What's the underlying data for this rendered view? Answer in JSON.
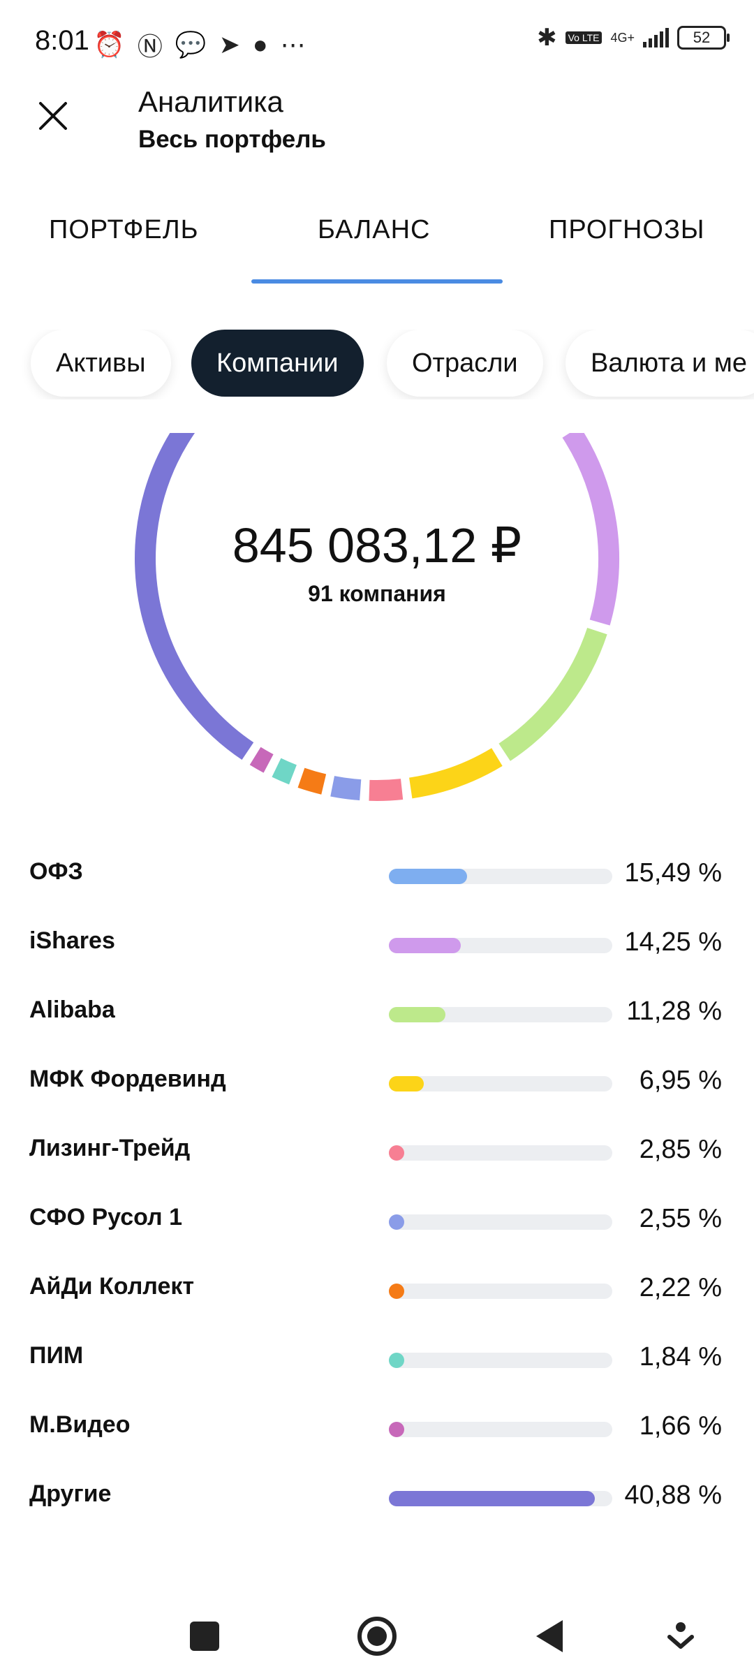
{
  "status": {
    "time": "8:01",
    "battery": "52",
    "network": "4G+",
    "volte": "Vo LTE"
  },
  "header": {
    "title": "Аналитика",
    "subtitle": "Весь портфель"
  },
  "tabs": [
    {
      "label": "ПОРТФЕЛЬ"
    },
    {
      "label": "БАЛАНС"
    },
    {
      "label": "ПРОГНОЗЫ"
    }
  ],
  "chips": [
    {
      "label": "Активы"
    },
    {
      "label": "Компании"
    },
    {
      "label": "Отрасли"
    },
    {
      "label": "Валюта и ме"
    }
  ],
  "summary": {
    "total": "845 083,12 ₽",
    "count": "91 компания"
  },
  "chart_data": {
    "type": "pie",
    "categories": [
      "ОФЗ",
      "iShares",
      "Alibaba",
      "МФК Фордевинд",
      "Лизинг-Трейд",
      "СФО Русол 1",
      "АйДи Коллект",
      "ПИМ",
      "М.Видео",
      "Другие"
    ],
    "values": [
      15.49,
      14.25,
      11.28,
      6.95,
      2.85,
      2.55,
      2.22,
      1.84,
      1.66,
      40.88
    ],
    "labels": [
      "15,49 %",
      "14,25 %",
      "11,28 %",
      "6,95 %",
      "2,85 %",
      "2,55 %",
      "2,22 %",
      "1,84 %",
      "1,66 %",
      "40,88 %"
    ],
    "colors": [
      "#7eaef0",
      "#cf9aec",
      "#bde98b",
      "#fcd418",
      "#f77f93",
      "#8a9ce8",
      "#f57b16",
      "#6fd6c6",
      "#c768b9",
      "#7b76d6"
    ]
  }
}
